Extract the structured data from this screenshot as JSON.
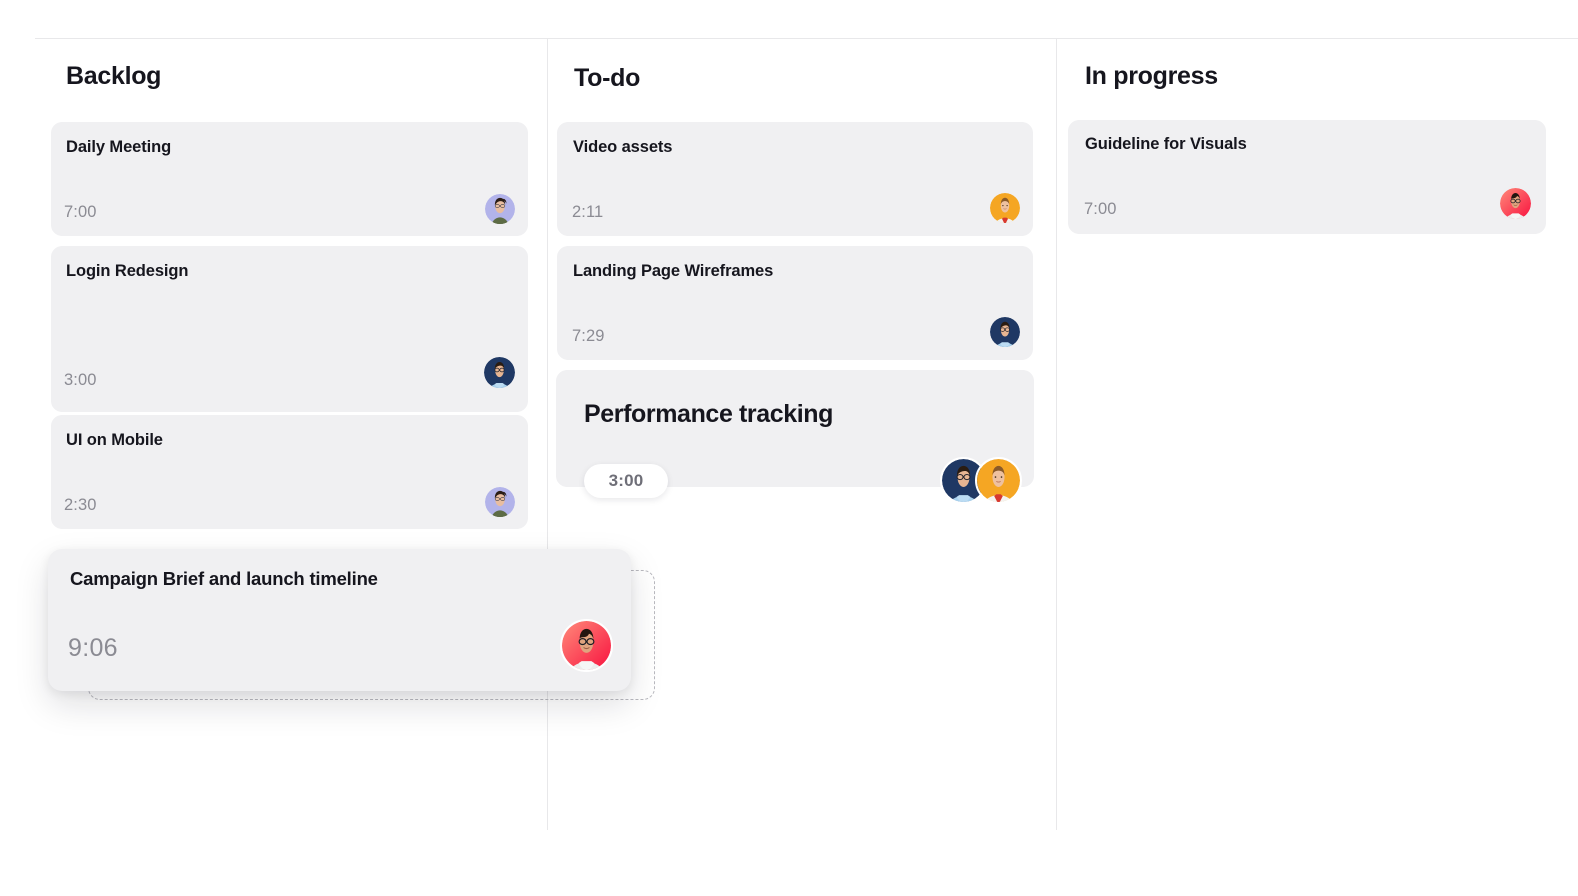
{
  "board": {
    "columns": [
      {
        "id": "backlog",
        "title": "Backlog",
        "cards": [
          {
            "title": "Daily Meeting",
            "time": "7:00",
            "avatar": "avatar-lavender-woman"
          },
          {
            "title": "Login Redesign",
            "time": "3:00",
            "avatar": "avatar-navy-man"
          },
          {
            "title": "UI on Mobile",
            "time": "2:30",
            "avatar": "avatar-lavender-woman"
          }
        ]
      },
      {
        "id": "todo",
        "title": "To-do",
        "cards": [
          {
            "title": "Video assets",
            "time": "2:11",
            "avatar": "avatar-amber-woman"
          },
          {
            "title": "Landing Page Wireframes",
            "time": "7:29",
            "avatar": "avatar-navy-man"
          },
          {
            "title": "Performance tracking",
            "time": "3:00",
            "avatars": [
              "avatar-navy-man",
              "avatar-amber-woman"
            ]
          }
        ]
      },
      {
        "id": "in-progress",
        "title": "In progress",
        "cards": [
          {
            "title": "Guideline for Visuals",
            "time": "7:00",
            "avatar": "avatar-red-man"
          }
        ]
      }
    ]
  },
  "drag": {
    "card": {
      "title": "Campaign Brief and launch timeline",
      "time": "9:06",
      "avatar": "avatar-red-man"
    },
    "placeholder_label": ""
  },
  "colors": {
    "card_bg": "#f0f0f2",
    "page_bg": "#ffffff",
    "title_text": "#16161e",
    "time_text": "#8b8b93",
    "divider": "#e8e8ea",
    "placeholder_border": "#b9b9bf",
    "avatar_lavender": "#b2b3ea",
    "avatar_navy": "#1f3864",
    "avatar_amber": "#f5a623",
    "avatar_red": "#fb3b58"
  }
}
